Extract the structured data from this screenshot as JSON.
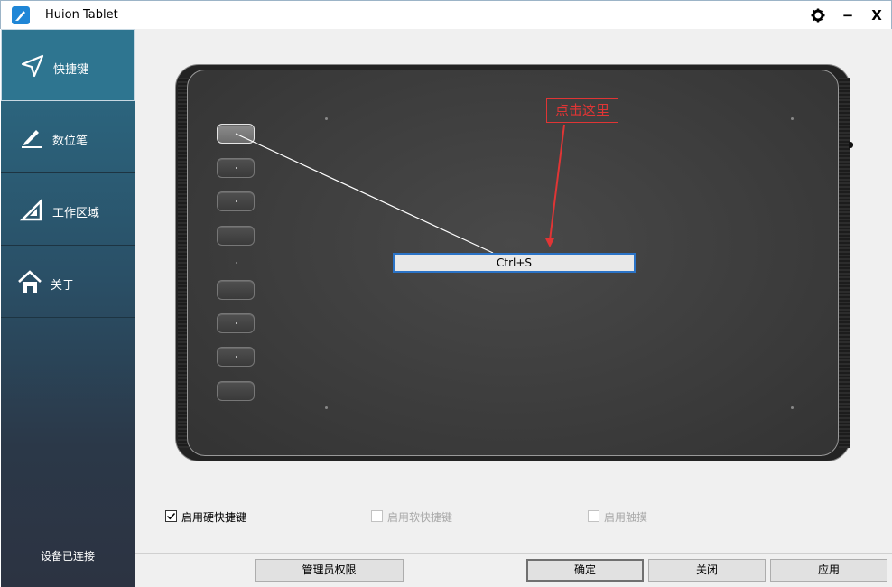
{
  "window": {
    "title": "Huion Tablet"
  },
  "titlebar": {
    "settings_icon": "gear-icon",
    "minimize_label": "−",
    "close_label": "X"
  },
  "sidebar": {
    "items": [
      {
        "label": "快捷键",
        "icon": "paper-plane-icon",
        "active": true
      },
      {
        "label": "数位笔",
        "icon": "pen-icon"
      },
      {
        "label": "工作区域",
        "icon": "triangle-ruler-icon"
      },
      {
        "label": "关于",
        "icon": "home-icon"
      }
    ],
    "status": "设备已连接"
  },
  "tablet": {
    "shortcut_value": "Ctrl+S",
    "express_keys": 8,
    "selected_key": 1
  },
  "annotation": {
    "text": "点击这里",
    "color": "#e03535"
  },
  "options": {
    "hard_shortcut": {
      "label": "启用硬快捷键",
      "checked": true
    },
    "soft_shortcut": {
      "label": "启用软快捷键",
      "checked": false,
      "disabled": true
    },
    "touch": {
      "label": "启用触摸",
      "checked": false,
      "disabled": true
    }
  },
  "buttons": {
    "admin": "管理员权限",
    "ok": "确定",
    "close": "关闭",
    "apply": "应用"
  },
  "colors": {
    "accent": "#2b73c6",
    "sidebar_top": "#2c6d87",
    "sidebar_bottom": "#2c3342"
  }
}
